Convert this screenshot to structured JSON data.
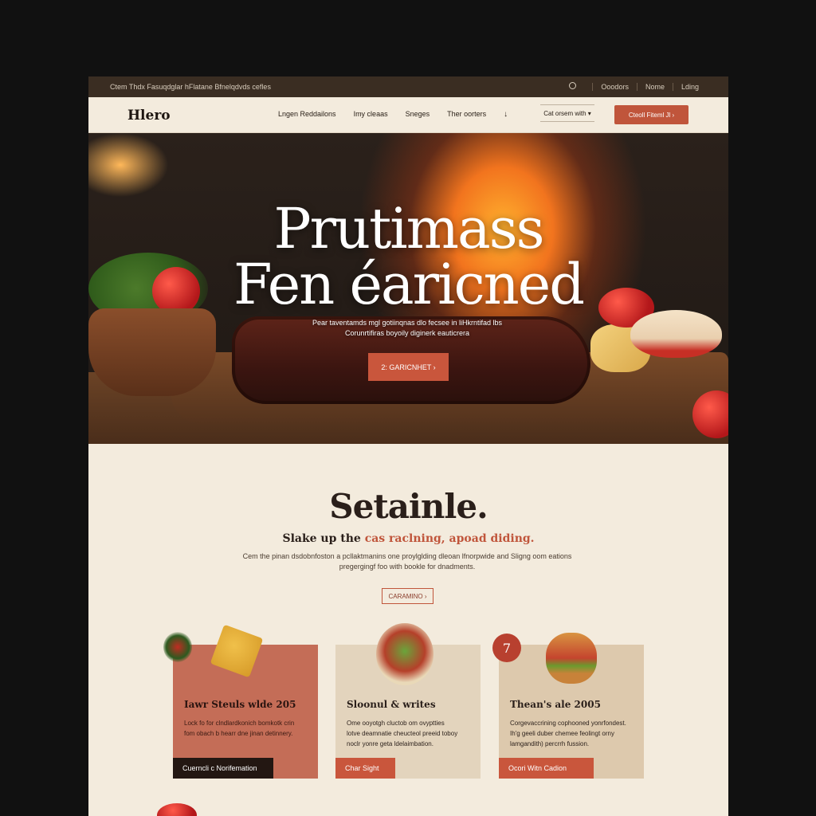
{
  "topbar": {
    "promo": "Ctem Thdx Fasuqdglar hFlatane Bfnelqdvds cefles",
    "links": [
      "Ooodors",
      "Nome",
      "Lding"
    ]
  },
  "nav": {
    "logo": "Hlero",
    "links": [
      "Lngen Reddailons",
      "Imy cleaas",
      "Sneges",
      "Ther oorters"
    ],
    "arrow": "↓",
    "field": "Cat orsem with ▾",
    "cta": "Cteoll Fiteml Jl ›"
  },
  "hero": {
    "title_line1": "Prutimass",
    "title_line2": "Fen éaricned",
    "subtitle_line1": "Pear taventamds mgl gotiinqnas dlo fecsee in liHkrntifad lbs",
    "subtitle_line2": "Corunrtifiras boyoily diginerk eauticrera",
    "cta": "2: GARICNHET ›"
  },
  "section": {
    "title": "Setainle.",
    "lead_prefix": "Slake up the ",
    "lead_accent": "cas raclning, apoad diding.",
    "body_line1": "Cem the pinan dsdobnfoston a pcllaktmanins one proylglding dleoan lfnorpwide and Sligng oom eations",
    "body_line2": "pregergingf foo with bookle for dnadments.",
    "button": "CARAMINO ›"
  },
  "cards": [
    {
      "title": "Iawr Steuls wlde 205",
      "text_line1": "Lock fo for clndlardkonich bomkotk crin",
      "text_line2": "fom obach b hearr dne jinan detinnery.",
      "button": "Cuerncli c Norifemation"
    },
    {
      "title": "Sloonul & writes",
      "text_line1": "Ome ooyotgh cluctob om ovyptties",
      "text_line2": "lotve deamnatie cheucteol preeid toboy",
      "text_line3": "noclr yonre geta ldelaimbation.",
      "button": "Char Sight"
    },
    {
      "title": "Thean's ale 2005",
      "badge": "7",
      "text_line1": "Corgevaccrining cophooned yonrfondest.",
      "text_line2": "Ih'g geeli duber chemee feolingt orny",
      "text_line3": "lamgandith) percrrh fussion.",
      "button": "Ocori Witn Cadion"
    }
  ]
}
